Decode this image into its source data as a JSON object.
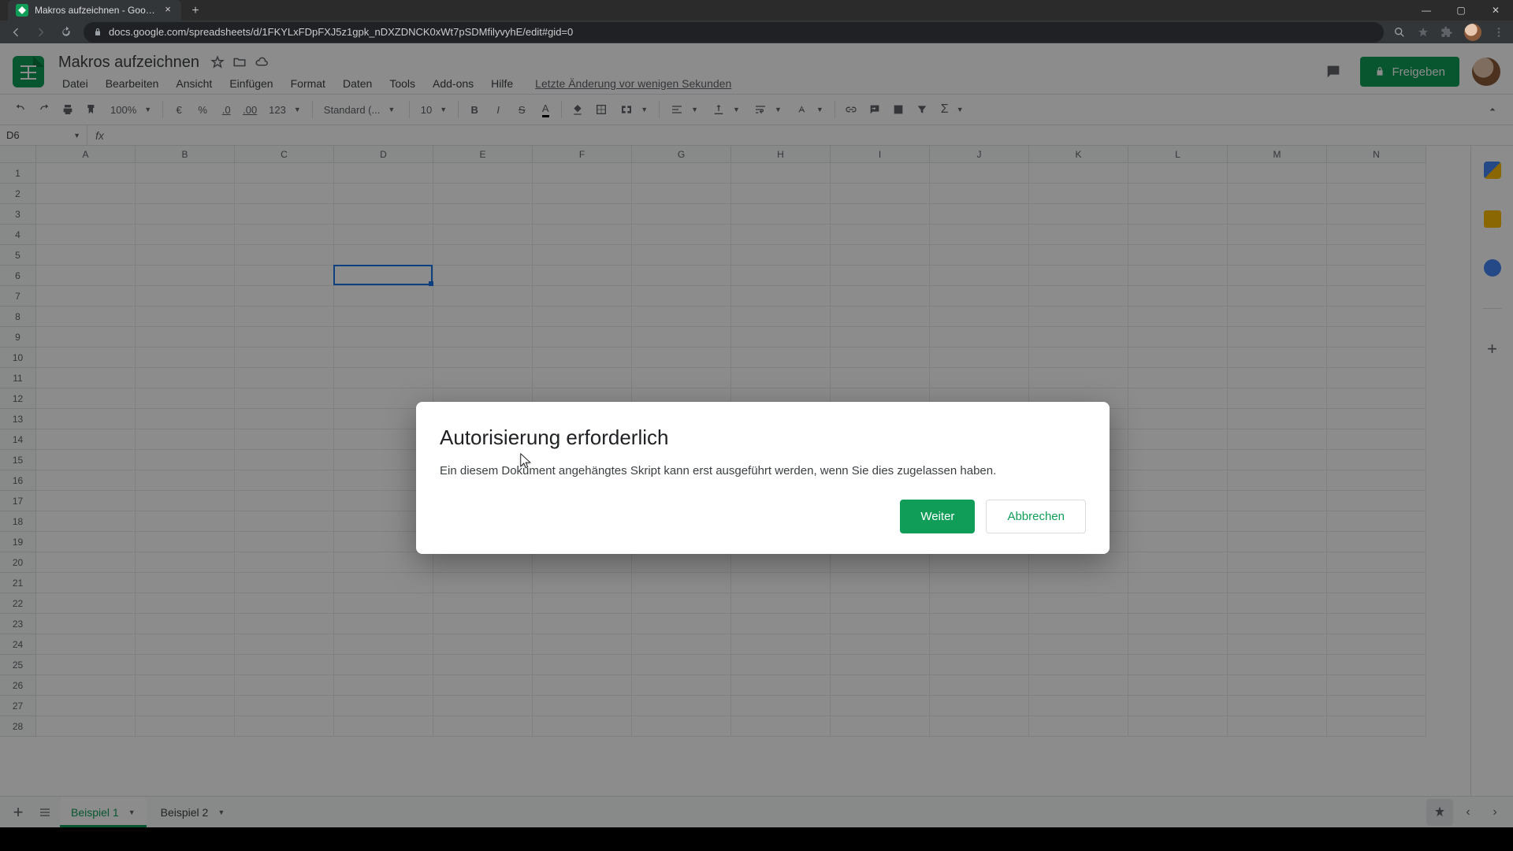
{
  "browser": {
    "tab_title": "Makros aufzeichnen - Google Ta",
    "url": "docs.google.com/spreadsheets/d/1FKYLxFDpFXJ5z1gpk_nDXZDNCK0xWt7pSDMfilyvyhE/edit#gid=0"
  },
  "doc": {
    "title": "Makros aufzeichnen",
    "last_edit": "Letzte Änderung vor wenigen Sekunden",
    "share_label": "Freigeben"
  },
  "menus": {
    "file": "Datei",
    "edit": "Bearbeiten",
    "view": "Ansicht",
    "insert": "Einfügen",
    "format": "Format",
    "data": "Daten",
    "tools": "Tools",
    "addons": "Add-ons",
    "help": "Hilfe"
  },
  "toolbar": {
    "zoom": "100%",
    "currency": "€",
    "percent": "%",
    "dec_dec": ".0",
    "inc_dec": ".00",
    "format_menu": "123",
    "font": "Standard (...",
    "font_size": "10"
  },
  "namebox": {
    "ref": "D6"
  },
  "columns": [
    "A",
    "B",
    "C",
    "D",
    "E",
    "F",
    "G",
    "H",
    "I",
    "J",
    "K",
    "L",
    "M",
    "N"
  ],
  "rows_count": 28,
  "selection": {
    "col_index": 3,
    "row_index": 5
  },
  "sheets": {
    "tab1": "Beispiel 1",
    "tab2": "Beispiel 2"
  },
  "modal": {
    "title": "Autorisierung erforderlich",
    "body": "Ein diesem Dokument angehängtes Skript kann erst ausgeführt werden, wenn Sie dies zugelassen haben.",
    "continue": "Weiter",
    "cancel": "Abbrechen"
  },
  "colors": {
    "accent": "#0f9d58",
    "selection": "#1a73e8"
  }
}
